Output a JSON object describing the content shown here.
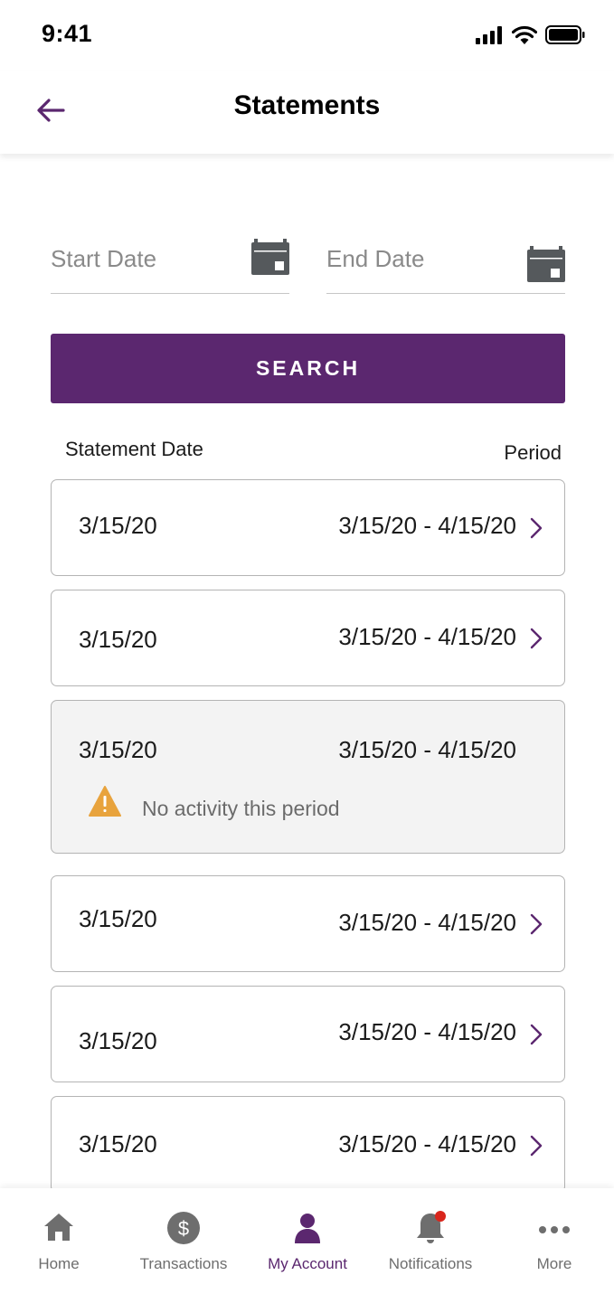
{
  "status_bar": {
    "time": "9:41"
  },
  "header": {
    "title": "Statements"
  },
  "filters": {
    "start_date": {
      "placeholder": "Start Date",
      "value": ""
    },
    "end_date": {
      "placeholder": "End Date",
      "value": ""
    },
    "search_label": "SEARCH"
  },
  "columns": {
    "statement_date": "Statement Date",
    "period": "Period"
  },
  "statements": [
    {
      "date": "3/15/20",
      "period": "3/15/20 - 4/15/20"
    },
    {
      "date": "3/15/20",
      "period": "3/15/20 - 4/15/20"
    },
    {
      "date": "3/15/20",
      "period": "3/15/20 - 4/15/20",
      "notice": "No activity this period"
    },
    {
      "date": "3/15/20",
      "period": "3/15/20 - 4/15/20"
    },
    {
      "date": "3/15/20",
      "period": "3/15/20 - 4/15/20"
    },
    {
      "date": "3/15/20",
      "period": "3/15/20 - 4/15/20"
    }
  ],
  "tabbar": {
    "items": [
      {
        "label": "Home",
        "icon": "home-icon",
        "active": false
      },
      {
        "label": "Transactions",
        "icon": "dollar-icon",
        "active": false
      },
      {
        "label": "My Account",
        "icon": "person-icon",
        "active": true
      },
      {
        "label": "Notifications",
        "icon": "bell-icon",
        "active": false,
        "badge": true
      },
      {
        "label": "More",
        "icon": "more-icon",
        "active": false
      }
    ]
  },
  "colors": {
    "brand": "#5b276f",
    "icon_gray": "#55595c",
    "tab_gray": "#6e6e6e",
    "warning": "#e8a33d",
    "badge": "#d9261c",
    "card_border": "#b4b4b4",
    "muted_bg": "#f3f3f3"
  }
}
